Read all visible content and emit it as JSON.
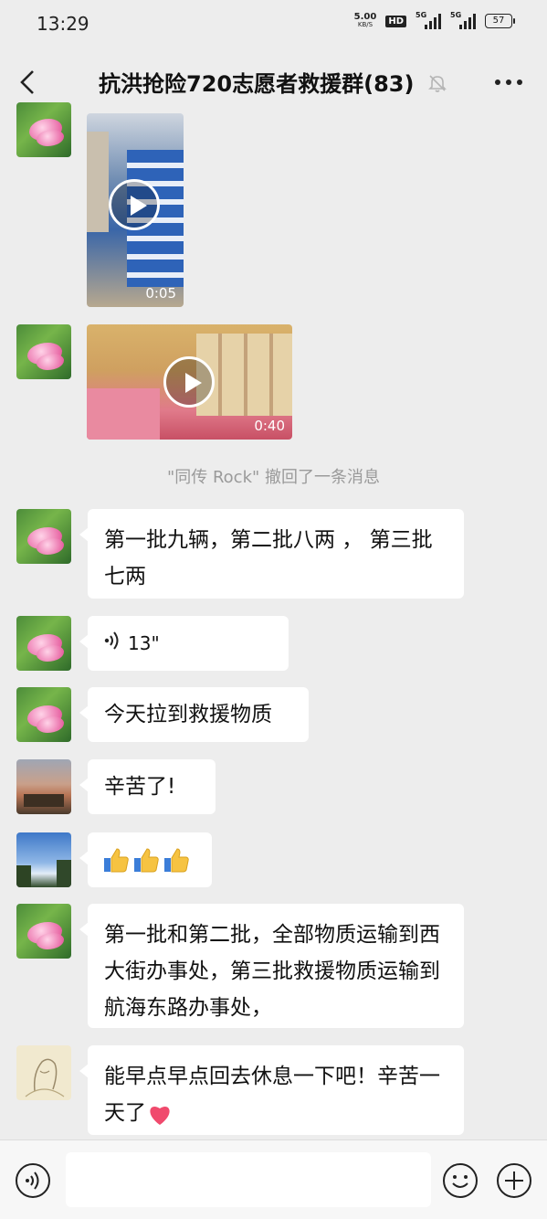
{
  "status": {
    "time": "13:29",
    "speed_value": "5.00",
    "speed_unit": "KB/S",
    "hd": "HD",
    "net1": "5G",
    "net2": "5G",
    "battery": "57"
  },
  "header": {
    "title": "抗洪抢险720志愿者救援群(83)",
    "icons": [
      "back-arrow-icon",
      "bell-muted-icon",
      "more-dots-icon"
    ]
  },
  "messages": {
    "video1_duration": "0:05",
    "video2_duration": "0:40",
    "recall_notice": "\"同传 Rock\" 撤回了一条消息",
    "text1": "第一批九辆，第二批八两 ， 第三批七两",
    "voice_duration": "13\"",
    "text2": "今天拉到救援物质",
    "text3": "辛苦了!",
    "text4": "第一批和第二批，全部物质运输到西大街办事处，第三批救援物质运输到航海东路办事处，",
    "text5": "能早点早点回去休息一下吧！辛苦一天了"
  },
  "input_bar": {
    "placeholder": "",
    "icons": [
      "voice-icon",
      "emoji-icon",
      "plus-icon"
    ]
  },
  "colors": {
    "background": "#ededed",
    "bubble": "#ffffff",
    "system_text": "#9a9a9a"
  }
}
